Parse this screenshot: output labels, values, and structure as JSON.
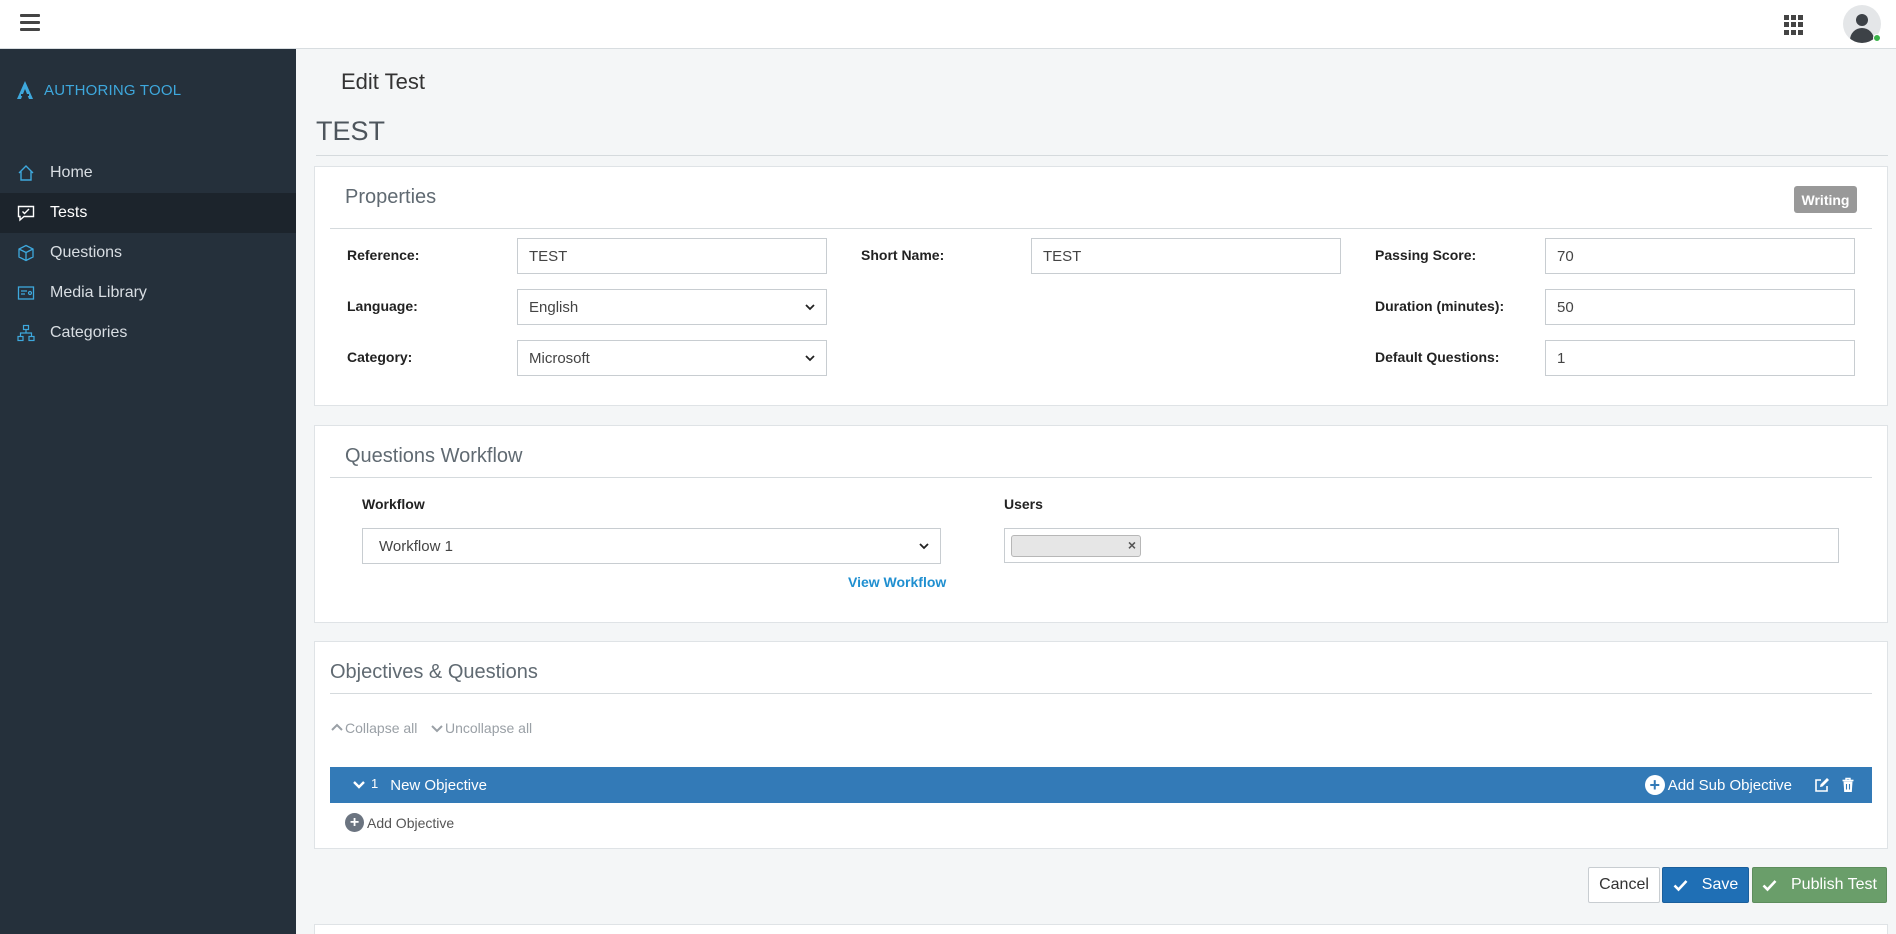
{
  "topbar": {
    "menu_icon": "hamburger-icon",
    "apps_icon": "grid-icon",
    "user_icon": "user-avatar-icon",
    "status_color": "#3cb34a"
  },
  "sidebar": {
    "brand": "AUTHORING TOOL",
    "brand_color": "#3ea8dd",
    "items": [
      {
        "label": "Home",
        "icon": "home-icon"
      },
      {
        "label": "Tests",
        "icon": "chat-icon",
        "active": true
      },
      {
        "label": "Questions",
        "icon": "cube-icon"
      },
      {
        "label": "Media Library",
        "icon": "media-icon"
      },
      {
        "label": "Categories",
        "icon": "sitemap-icon"
      }
    ]
  },
  "page": {
    "heading": "Edit Test",
    "test_title": "TEST"
  },
  "properties": {
    "title": "Properties",
    "status_badge": "Writing",
    "reference": {
      "label": "Reference:",
      "value": "TEST"
    },
    "short_name": {
      "label": "Short Name:",
      "value": "TEST"
    },
    "passing_score": {
      "label": "Passing Score:",
      "value": "70"
    },
    "language": {
      "label": "Language:",
      "value": "English"
    },
    "duration": {
      "label": "Duration (minutes):",
      "value": "50"
    },
    "category": {
      "label": "Category:",
      "value": "Microsoft"
    },
    "default_questions": {
      "label": "Default Questions:",
      "value": "1"
    }
  },
  "workflow": {
    "title": "Questions Workflow",
    "workflow_label": "Workflow",
    "workflow_value": "Workflow 1",
    "users_label": "Users",
    "view_link": "View Workflow",
    "user_tag_remove": "×"
  },
  "objectives": {
    "title": "Objectives & Questions",
    "collapse_all": "Collapse all",
    "uncollapse_all": "Uncollapse all",
    "items": [
      {
        "number": "1",
        "name": "New Objective"
      }
    ],
    "add_sub_objective": "Add Sub Objective",
    "add_objective": "Add Objective",
    "bar_color": "#337ab7"
  },
  "actions": {
    "cancel": "Cancel",
    "save": "Save",
    "publish": "Publish Test"
  }
}
